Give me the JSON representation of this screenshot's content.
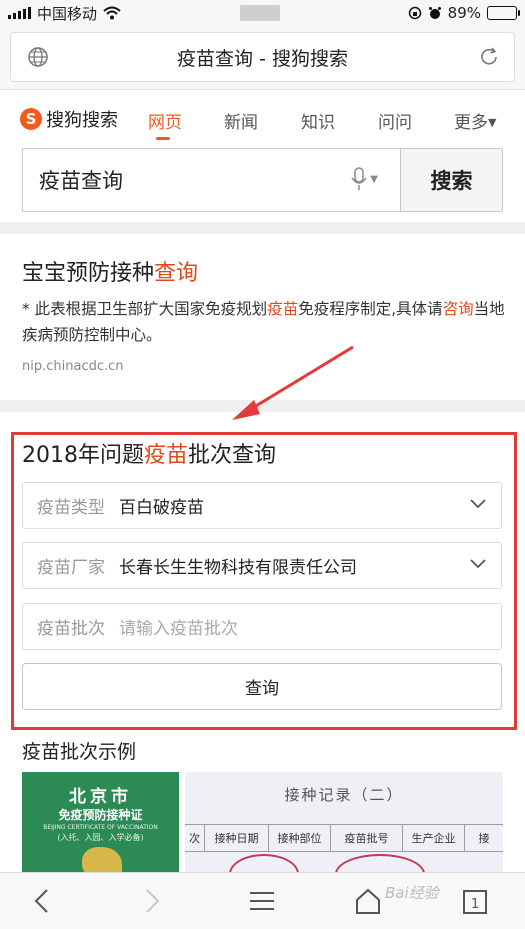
{
  "status_bar": {
    "carrier": "中国移动",
    "battery": "89%",
    "battery_level": 0.89
  },
  "browser": {
    "url_title": "疫苗查询 - 搜狗搜索"
  },
  "sogou": {
    "logo_text": "搜狗搜索",
    "tabs": [
      {
        "label": "网页"
      },
      {
        "label": "新闻"
      },
      {
        "label": "知识"
      },
      {
        "label": "问问"
      },
      {
        "label": "更多"
      }
    ],
    "search": {
      "query": "疫苗查询",
      "button": "搜索"
    }
  },
  "result1": {
    "title_pre": "宝宝预防接种",
    "title_hl": "查询",
    "desc_a": "* 此表根据卫生部扩大国家免疫规划",
    "desc_hl1": "疫苗",
    "desc_b": "免疫程序制定,具体请",
    "desc_hl2": "咨询",
    "desc_c": "当地疾病预防控制中心。",
    "url": "nip.chinacdc.cn"
  },
  "query_card": {
    "title_pre": "2018年问题",
    "title_hl": "疫苗",
    "title_post": "批次查询",
    "type_label": "疫苗类型",
    "type_value": "百白破疫苗",
    "maker_label": "疫苗厂家",
    "maker_value": "长春长生生物科技有限责任公司",
    "batch_label": "疫苗批次",
    "batch_placeholder": "请输入疫苗批次",
    "query_button": "查询"
  },
  "examples": {
    "title": "疫苗批次示例",
    "card1": {
      "line1": "北京市",
      "line2": "免疫预防接种证",
      "line3": "BEIJING CERTIFICATE OF VACCINATION",
      "line4": "(入托、入园、入学必备)"
    },
    "card2": {
      "heading": "接种记录（二）",
      "cols": [
        "次",
        "接种日期",
        "接种部位",
        "疫苗批号",
        "生产企业",
        "接"
      ]
    }
  },
  "watermark": "Bai经验"
}
